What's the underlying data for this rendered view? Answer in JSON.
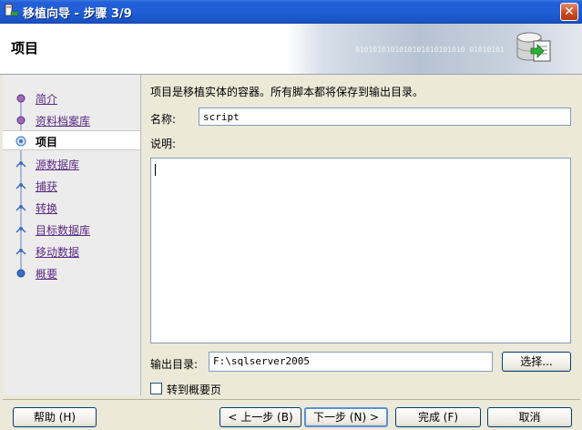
{
  "window": {
    "title": "移植向导 - 步骤 3/9",
    "close_glyph": "✕"
  },
  "banner": {
    "title": "项目",
    "binary_text": "0101010101010101010101010  01010101"
  },
  "nav": {
    "items": [
      {
        "label": "简介"
      },
      {
        "label": "资料档案库"
      },
      {
        "label": "项目",
        "selected": true
      },
      {
        "label": "源数据库"
      },
      {
        "label": "捕获"
      },
      {
        "label": "转换"
      },
      {
        "label": "目标数据库"
      },
      {
        "label": "移动数据"
      },
      {
        "label": "概要"
      }
    ]
  },
  "form": {
    "description": "项目是移植实体的容器。所有脚本都将保存到输出目录。",
    "name_label": "名称:",
    "name_value": "script",
    "desc_label": "说明:",
    "desc_value": "",
    "output_label": "输出目录:",
    "output_value": "F:\\sqlserver2005",
    "browse_label": "选择...",
    "goto_summary_label": "转到概要页",
    "goto_summary_checked": false
  },
  "buttons": {
    "help": "帮助 (H)",
    "prev": "< 上一步 (B)",
    "next": "下一步 (N) >",
    "finish": "完成 (F)",
    "cancel": "取消"
  },
  "colors": {
    "titlebar": "#1f5fd6",
    "link": "#5b2a82",
    "node": "#3b6fc8"
  }
}
